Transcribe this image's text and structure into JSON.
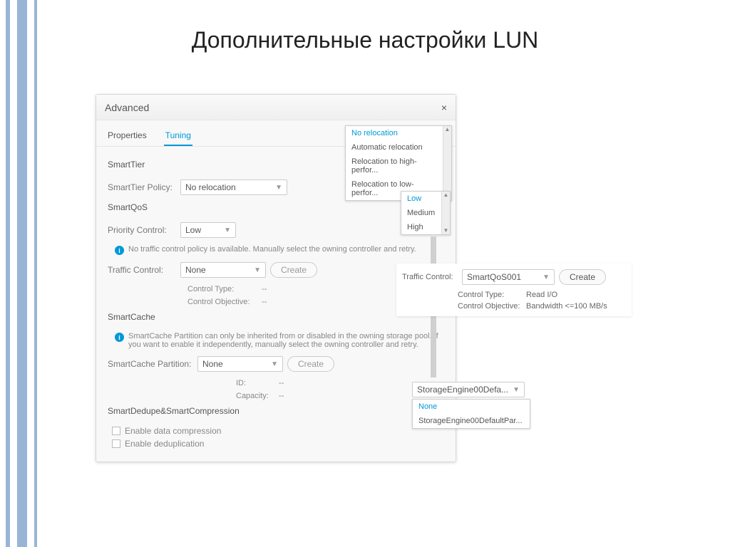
{
  "slide": {
    "title": "Дополнительные настройки LUN"
  },
  "dialog": {
    "title": "Advanced",
    "tabs": {
      "properties": "Properties",
      "tuning": "Tuning"
    }
  },
  "smartTier": {
    "heading": "SmartTier",
    "policyLabel": "SmartTier Policy:",
    "policyValue": "No relocation",
    "options": [
      "No relocation",
      "Automatic relocation",
      "Relocation to high-perfor...",
      "Relocation to low-perfor..."
    ]
  },
  "smartQos": {
    "heading": "SmartQoS",
    "priorityLabel": "Priority Control:",
    "priorityValue": "Low",
    "priorityOptions": [
      "Low",
      "Medium",
      "High"
    ],
    "infoText": "No traffic control policy is available. Manually select the owning controller and retry.",
    "trafficLabel": "Traffic Control:",
    "trafficValue": "None",
    "createBtn": "Create",
    "controlTypeLabel": "Control Type:",
    "controlTypeValue": "--",
    "controlObjLabel": "Control Objective:",
    "controlObjValue": "--"
  },
  "smartCache": {
    "heading": "SmartCache",
    "infoText": "SmartCache Partition can only be inherited from or disabled in the owning storage pool. If you want to enable it independently, manually select the owning controller and retry.",
    "partitionLabel": "SmartCache Partition:",
    "partitionValue": "None",
    "createBtn": "Create",
    "idLabel": "ID:",
    "idValue": "--",
    "capacityLabel": "Capacity:",
    "capacityValue": "--"
  },
  "dedupe": {
    "heading": "SmartDedupe&SmartCompression",
    "compression": "Enable data compression",
    "deduplication": "Enable deduplication"
  },
  "traffic2": {
    "label": "Traffic Control:",
    "value": "SmartQoS001",
    "createBtn": "Create",
    "controlTypeLabel": "Control Type:",
    "controlTypeValue": "Read I/O",
    "controlObjLabel": "Control Objective:",
    "controlObjValue": "Bandwidth <=100 MB/s"
  },
  "cache2": {
    "selectValue": "StorageEngine00Defa...",
    "options": [
      "None",
      "StorageEngine00DefaultPar..."
    ]
  }
}
